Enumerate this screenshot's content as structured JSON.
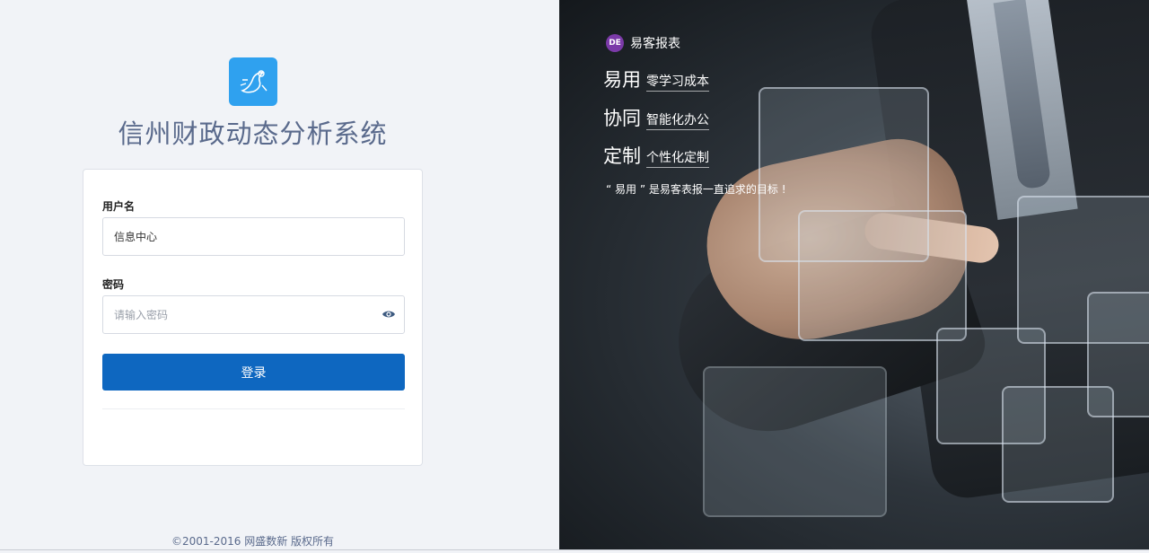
{
  "app": {
    "title": "信州财政动态分析系统"
  },
  "login_form": {
    "username_label": "用户名",
    "username_value": "信息中心",
    "password_label": "密码",
    "password_placeholder": "请输入密码",
    "submit_label": "登录"
  },
  "footer": {
    "copyright": "©2001-2016 网盛数新 版权所有"
  },
  "promo": {
    "brand_logo_text": "DE",
    "brand_name": "易客报表",
    "slogans": [
      {
        "big": "易用",
        "small": "零学习成本"
      },
      {
        "big": "协同",
        "small": "智能化办公"
      },
      {
        "big": "定制",
        "small": "个性化定制"
      }
    ],
    "tagline": "“ 易用 ” 是易客表报一直追求的目标 !"
  },
  "colors": {
    "accent": "#0e67c0",
    "logo_bg": "#2fa1ef",
    "title_text": "#5a6a8c",
    "brand_logo_bg": "#7b3aa8"
  },
  "icons": {
    "app_logo": "runner-logo-icon",
    "password_toggle": "eye-icon"
  }
}
